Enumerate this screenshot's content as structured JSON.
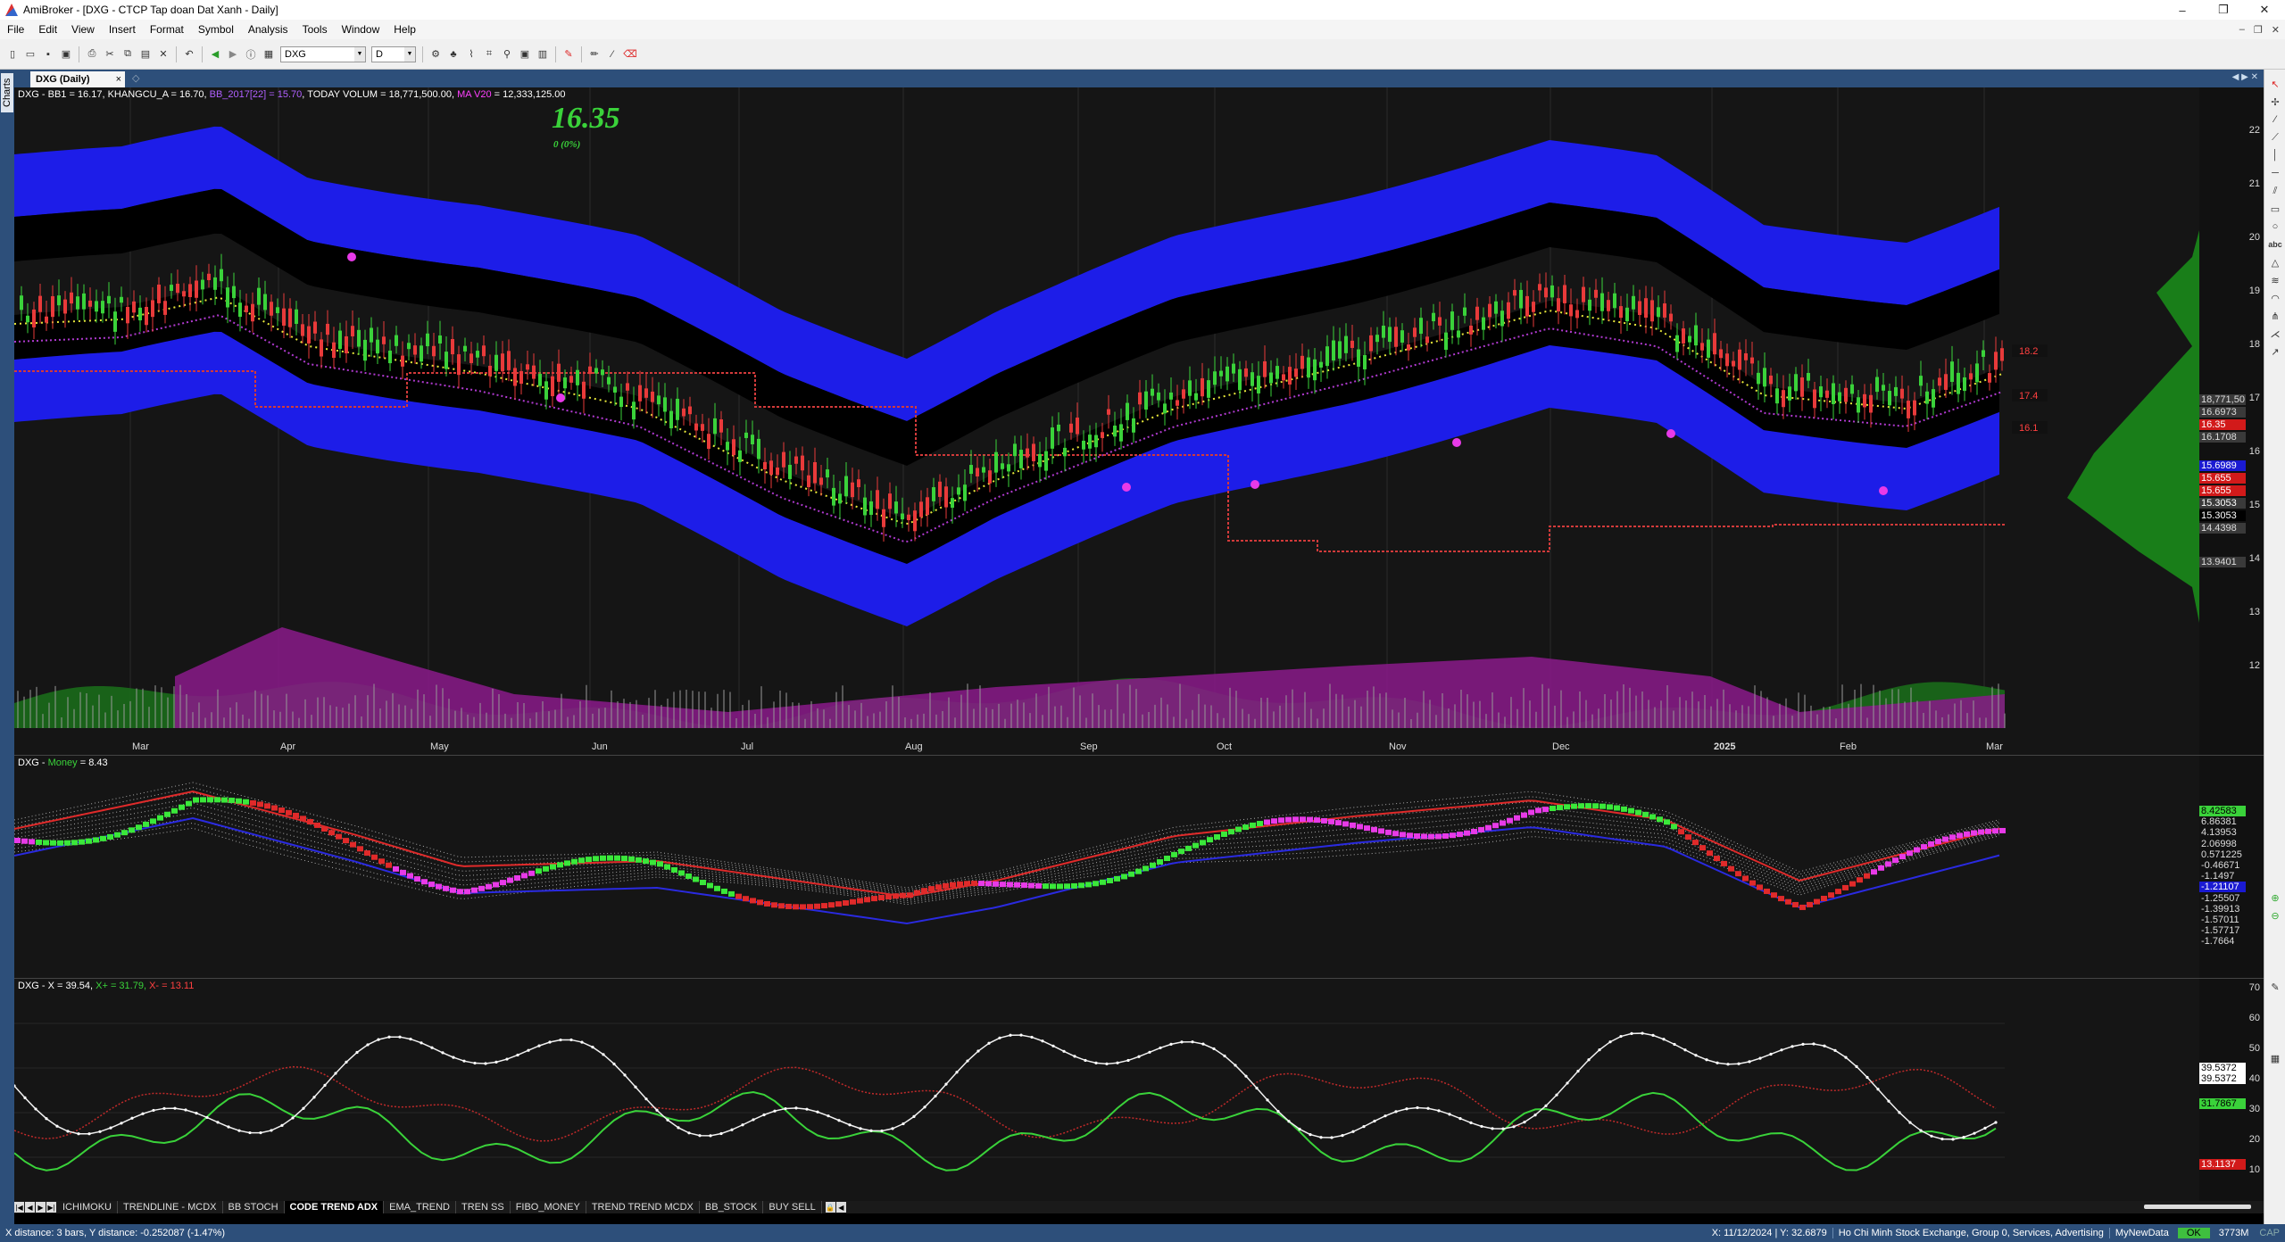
{
  "window": {
    "title": "AmiBroker - [DXG - CTCP Tap doan Dat Xanh - Daily]"
  },
  "menu": [
    "File",
    "Edit",
    "View",
    "Insert",
    "Format",
    "Symbol",
    "Analysis",
    "Tools",
    "Window",
    "Help"
  ],
  "toolbar": {
    "symbol": "DXG",
    "interval": "D"
  },
  "sidebar": {
    "charts_tab": "Charts"
  },
  "chart_tab": {
    "label": "DXG (Daily)",
    "close": "×"
  },
  "price_pane": {
    "header": {
      "prefix": "DXG - BB1 = 16.17, KHANGCU_A = 16.70, ",
      "mid_purple": "BB_2017[22] = 15.70",
      "after_mid": ", TODAY VOLUM = 18,771,500.00, ",
      "ma_label": "MA V20",
      "ma_value": " = 12,333,125.00"
    },
    "big_price": "16.35",
    "change": "0 (0%)",
    "yticks": [
      "22",
      "21",
      "20",
      "19",
      "18",
      "17",
      "16",
      "15",
      "14",
      "13",
      "12"
    ],
    "right_tags": [
      {
        "text": "18,771,50",
        "bg": "#3a3a3a",
        "fg": "#ddd"
      },
      {
        "text": "16.6973",
        "bg": "#3a3a3a",
        "fg": "#ddd"
      },
      {
        "text": "16.35",
        "bg": "#d21a1a",
        "fg": "#fff"
      },
      {
        "text": "16.1708",
        "bg": "#3a3a3a",
        "fg": "#ddd"
      },
      {
        "text": "15.6989",
        "bg": "#1a1ad2",
        "fg": "#fff"
      },
      {
        "text": "15.655",
        "bg": "#d21a1a",
        "fg": "#fff"
      },
      {
        "text": "15.655",
        "bg": "#d21a1a",
        "fg": "#fff"
      },
      {
        "text": "15.3053",
        "bg": "#3a3a3a",
        "fg": "#fff"
      },
      {
        "text": "15.3053",
        "bg": "#000",
        "fg": "#fff"
      },
      {
        "text": "14.4398",
        "bg": "#3a3a3a",
        "fg": "#ddd"
      },
      {
        "text": "13.9401",
        "bg": "#3a3a3a",
        "fg": "#ddd"
      }
    ],
    "box_labels": [
      "18.2",
      "17.4",
      "16.1"
    ],
    "months": [
      "Mar",
      "Apr",
      "May",
      "Jun",
      "Jul",
      "Aug",
      "Sep",
      "Oct",
      "Nov",
      "Dec",
      "2025",
      "Feb",
      "Mar"
    ]
  },
  "money_pane": {
    "header_prefix": "DXG - ",
    "name": "Money",
    "value": " = 8.43",
    "tags": [
      {
        "text": "8.42583",
        "bg": "#3ad23a",
        "fg": "#000"
      },
      {
        "text": "6.86381",
        "bg": "#111",
        "fg": "#ddd"
      },
      {
        "text": "4.13953",
        "bg": "#111",
        "fg": "#ddd"
      },
      {
        "text": "2.06998",
        "bg": "#111",
        "fg": "#ddd"
      },
      {
        "text": "0.571225",
        "bg": "#111",
        "fg": "#ddd"
      },
      {
        "text": "-0.46671",
        "bg": "#111",
        "fg": "#ddd"
      },
      {
        "text": "-1.1497",
        "bg": "#111",
        "fg": "#ddd"
      },
      {
        "text": "-1.21107",
        "bg": "#1a1ad2",
        "fg": "#fff"
      },
      {
        "text": "-1.25507",
        "bg": "#111",
        "fg": "#ddd"
      },
      {
        "text": "-1.39913",
        "bg": "#111",
        "fg": "#ddd"
      },
      {
        "text": "-1.57011",
        "bg": "#111",
        "fg": "#ddd"
      },
      {
        "text": "-1.57717",
        "bg": "#111",
        "fg": "#ddd"
      },
      {
        "text": "-1.7664",
        "bg": "#111",
        "fg": "#ddd"
      }
    ]
  },
  "dmi_pane": {
    "header_prefix": "DXG - X = 39.54, ",
    "xplus": "X+ = 31.79, ",
    "xminus": "X- = 13.11",
    "yticks": [
      "70",
      "60",
      "50",
      "40",
      "30",
      "20",
      "10"
    ],
    "tags": [
      {
        "text": "39.5372",
        "bg": "#fff",
        "fg": "#000"
      },
      {
        "text": "39.5372",
        "bg": "#fff",
        "fg": "#000"
      },
      {
        "text": "31.7867",
        "bg": "#3ad23a",
        "fg": "#000"
      },
      {
        "text": "13.1137",
        "bg": "#d21a1a",
        "fg": "#fff"
      }
    ]
  },
  "sheets": [
    "ICHIMOKU",
    "TRENDLINE - MCDX",
    "BB STOCH",
    "CODE TREND ADX",
    "EMA_TREND",
    "TREN SS",
    "FIBO_MONEY",
    "TREND TREND MCDX",
    "BB_STOCK",
    "BUY SELL"
  ],
  "active_sheet": "CODE TREND ADX",
  "status": {
    "left": "X distance: 3 bars, Y distance: -0.252087 (-1.47%)",
    "coords": "X: 11/12/2024 | Y: 32.6879",
    "exchange": "Ho Chi Minh Stock Exchange, Group 0, Services, Advertising",
    "db": "MyNewData",
    "ok": "OK",
    "mem": "3773M",
    "cap": "CAP"
  }
}
